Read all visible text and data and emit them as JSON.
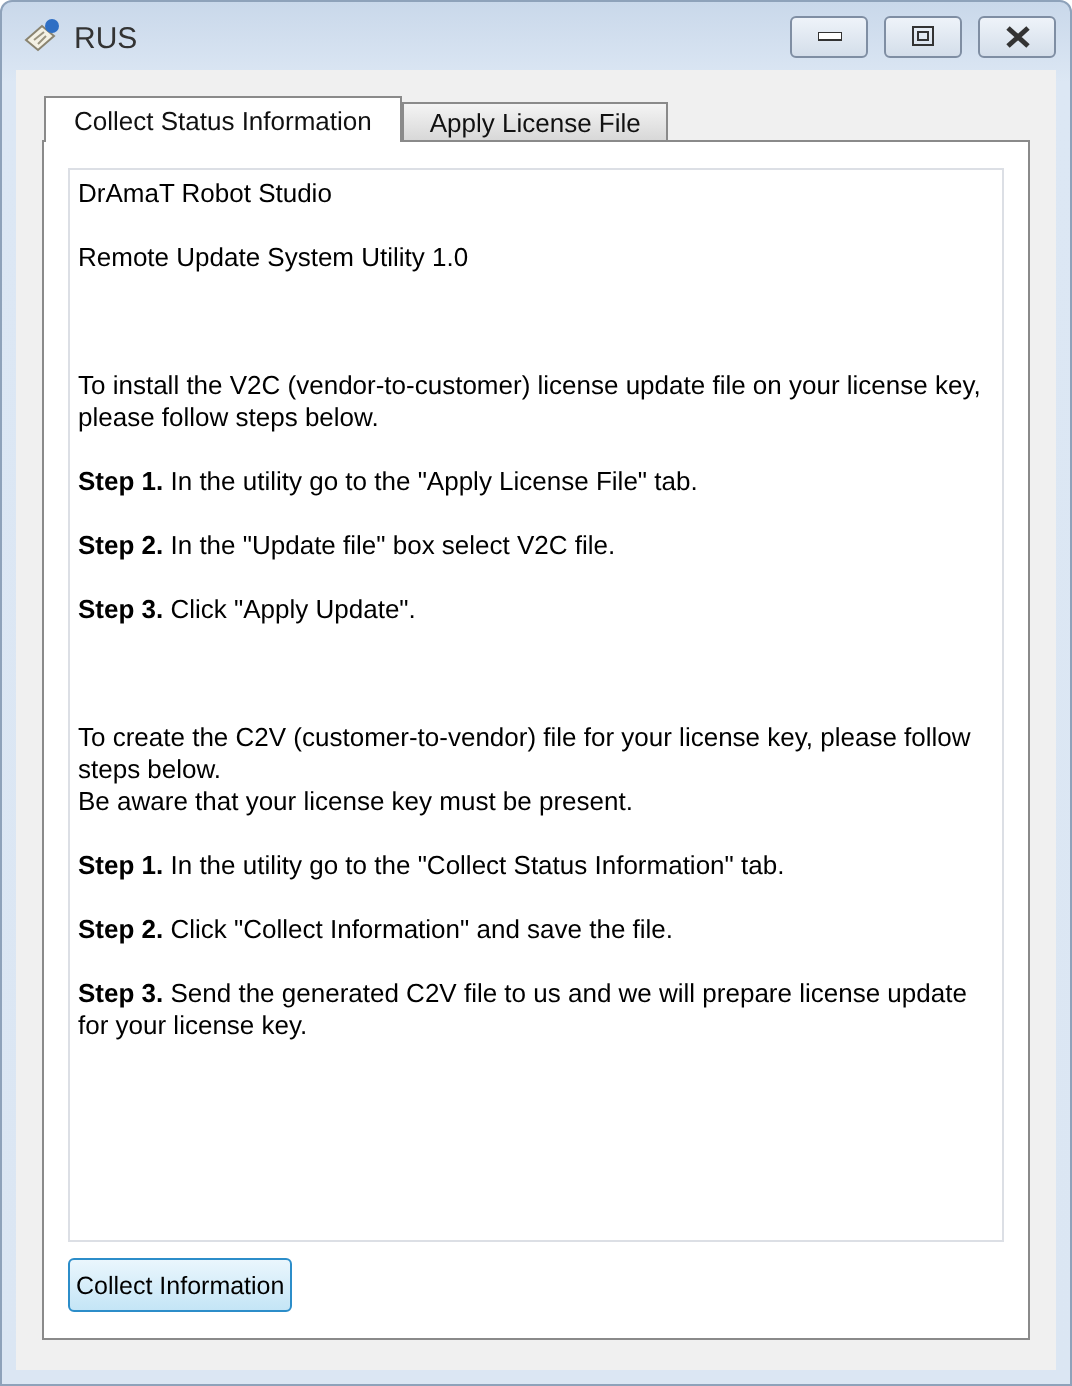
{
  "window": {
    "title": "RUS",
    "controls": [
      {
        "kind": "minimize"
      },
      {
        "kind": "maximize"
      },
      {
        "kind": "close"
      }
    ]
  },
  "tabs": [
    {
      "label": "Collect Status Information",
      "selected": true
    },
    {
      "label": "Apply License File",
      "selected": false
    }
  ],
  "info_sections": [
    {
      "paragraphs": [
        [
          "DrAmaT Robot Studio"
        ],
        [
          "Remote Update System Utility 1.0"
        ]
      ]
    },
    {
      "paragraphs": [
        [
          "To install the V2C (vendor-to-customer) license update file on your license key, please follow steps below."
        ],
        [
          "**Step 1.** In the utility go to the \"Apply License File\" tab."
        ],
        [
          "**Step 2.** In the \"Update file\" box select V2C file."
        ],
        [
          "**Step 3.** Click \"Apply Update\"."
        ]
      ]
    },
    {
      "paragraphs": [
        [
          "To create the C2V (customer-to-vendor) file for your license key, please follow steps below.",
          "Be aware that your license key must be present."
        ],
        [
          "**Step 1.** In the utility go to the \"Collect Status Information\" tab."
        ],
        [
          "**Step 2.** Click \"Collect Information\" and save the file."
        ],
        [
          "**Step 3.** Send the generated C2V file to us and we will prepare license update for your license key."
        ]
      ]
    }
  ],
  "button": {
    "label": "Collect Information"
  }
}
